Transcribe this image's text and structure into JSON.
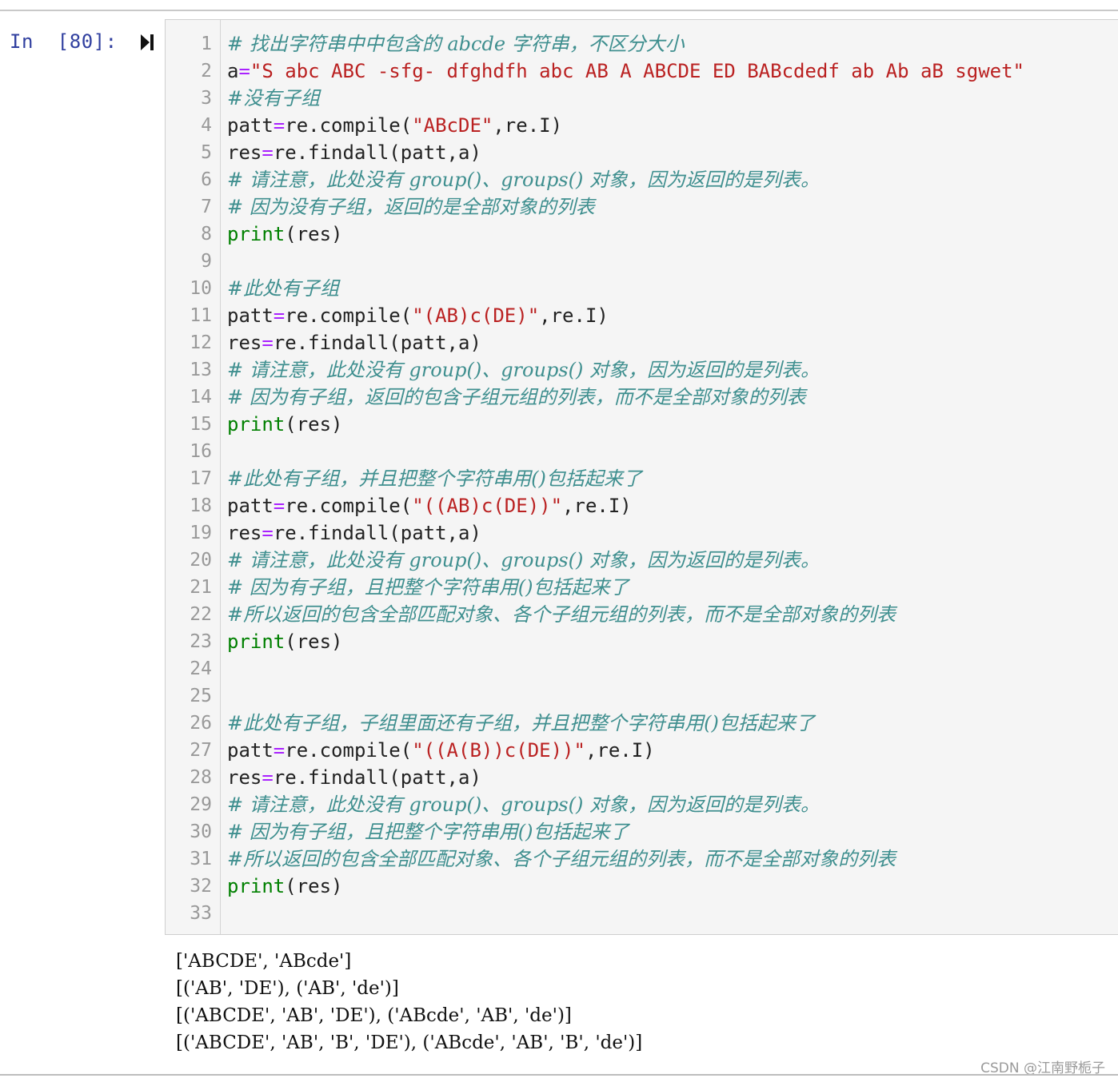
{
  "prompt": "In  [80]:",
  "lines": [
    {
      "n": "1",
      "parts": [
        {
          "t": "cm",
          "v": "# 找出字符串中中包含的 abcde 字符串，不区分大小"
        }
      ]
    },
    {
      "n": "2",
      "parts": [
        {
          "t": "tx",
          "v": "a"
        },
        {
          "t": "op",
          "v": "="
        },
        {
          "t": "st",
          "v": "\"S abc ABC -sfg- dfghdfh abc AB A ABCDE ED BABcdedf ab Ab aB sgwet\""
        }
      ]
    },
    {
      "n": "3",
      "parts": [
        {
          "t": "cm",
          "v": "#没有子组"
        }
      ]
    },
    {
      "n": "4",
      "parts": [
        {
          "t": "tx",
          "v": "patt"
        },
        {
          "t": "op",
          "v": "="
        },
        {
          "t": "tx",
          "v": "re.compile("
        },
        {
          "t": "st",
          "v": "\"ABcDE\""
        },
        {
          "t": "tx",
          "v": ",re.I)"
        }
      ]
    },
    {
      "n": "5",
      "parts": [
        {
          "t": "tx",
          "v": "res"
        },
        {
          "t": "op",
          "v": "="
        },
        {
          "t": "tx",
          "v": "re.findall(patt,a)"
        }
      ]
    },
    {
      "n": "6",
      "parts": [
        {
          "t": "cm",
          "v": "# 请注意，此处没有 group()、groups() 对象，因为返回的是列表。"
        }
      ]
    },
    {
      "n": "7",
      "parts": [
        {
          "t": "cm",
          "v": "# 因为没有子组，返回的是全部对象的列表"
        }
      ]
    },
    {
      "n": "8",
      "parts": [
        {
          "t": "kw",
          "v": "print"
        },
        {
          "t": "tx",
          "v": "(res)"
        }
      ]
    },
    {
      "n": "9",
      "parts": []
    },
    {
      "n": "10",
      "parts": [
        {
          "t": "cm",
          "v": "#此处有子组"
        }
      ]
    },
    {
      "n": "11",
      "parts": [
        {
          "t": "tx",
          "v": "patt"
        },
        {
          "t": "op",
          "v": "="
        },
        {
          "t": "tx",
          "v": "re.compile("
        },
        {
          "t": "st",
          "v": "\"(AB)c(DE)\""
        },
        {
          "t": "tx",
          "v": ",re.I)"
        }
      ]
    },
    {
      "n": "12",
      "parts": [
        {
          "t": "tx",
          "v": "res"
        },
        {
          "t": "op",
          "v": "="
        },
        {
          "t": "tx",
          "v": "re.findall(patt,a)"
        }
      ]
    },
    {
      "n": "13",
      "parts": [
        {
          "t": "cm",
          "v": "# 请注意，此处没有 group()、groups() 对象，因为返回的是列表。"
        }
      ]
    },
    {
      "n": "14",
      "parts": [
        {
          "t": "cm",
          "v": "# 因为有子组，返回的包含子组元组的列表，而不是全部对象的列表"
        }
      ]
    },
    {
      "n": "15",
      "parts": [
        {
          "t": "kw",
          "v": "print"
        },
        {
          "t": "tx",
          "v": "(res)"
        }
      ]
    },
    {
      "n": "16",
      "parts": []
    },
    {
      "n": "17",
      "parts": [
        {
          "t": "cm",
          "v": "#此处有子组，并且把整个字符串用()包括起来了"
        }
      ]
    },
    {
      "n": "18",
      "parts": [
        {
          "t": "tx",
          "v": "patt"
        },
        {
          "t": "op",
          "v": "="
        },
        {
          "t": "tx",
          "v": "re.compile("
        },
        {
          "t": "st",
          "v": "\"((AB)c(DE))\""
        },
        {
          "t": "tx",
          "v": ",re.I)"
        }
      ]
    },
    {
      "n": "19",
      "parts": [
        {
          "t": "tx",
          "v": "res"
        },
        {
          "t": "op",
          "v": "="
        },
        {
          "t": "tx",
          "v": "re.findall(patt,a)"
        }
      ]
    },
    {
      "n": "20",
      "parts": [
        {
          "t": "cm",
          "v": "# 请注意，此处没有 group()、groups() 对象，因为返回的是列表。"
        }
      ]
    },
    {
      "n": "21",
      "parts": [
        {
          "t": "cm",
          "v": "# 因为有子组，且把整个字符串用()包括起来了"
        }
      ]
    },
    {
      "n": "22",
      "parts": [
        {
          "t": "cm",
          "v": "#所以返回的包含全部匹配对象、各个子组元组的列表，而不是全部对象的列表"
        }
      ]
    },
    {
      "n": "23",
      "parts": [
        {
          "t": "kw",
          "v": "print"
        },
        {
          "t": "tx",
          "v": "(res)"
        }
      ]
    },
    {
      "n": "24",
      "parts": []
    },
    {
      "n": "25",
      "parts": []
    },
    {
      "n": "26",
      "parts": [
        {
          "t": "cm",
          "v": "#此处有子组，子组里面还有子组，并且把整个字符串用()包括起来了"
        }
      ]
    },
    {
      "n": "27",
      "parts": [
        {
          "t": "tx",
          "v": "patt"
        },
        {
          "t": "op",
          "v": "="
        },
        {
          "t": "tx",
          "v": "re.compile("
        },
        {
          "t": "st",
          "v": "\"((A(B))c(DE))\""
        },
        {
          "t": "tx",
          "v": ",re.I)"
        }
      ]
    },
    {
      "n": "28",
      "parts": [
        {
          "t": "tx",
          "v": "res"
        },
        {
          "t": "op",
          "v": "="
        },
        {
          "t": "tx",
          "v": "re.findall(patt,a)"
        }
      ]
    },
    {
      "n": "29",
      "parts": [
        {
          "t": "cm",
          "v": "# 请注意，此处没有 group()、groups() 对象，因为返回的是列表。"
        }
      ]
    },
    {
      "n": "30",
      "parts": [
        {
          "t": "cm",
          "v": "# 因为有子组，且把整个字符串用()包括起来了"
        }
      ]
    },
    {
      "n": "31",
      "parts": [
        {
          "t": "cm",
          "v": "#所以返回的包含全部匹配对象、各个子组元组的列表，而不是全部对象的列表"
        }
      ]
    },
    {
      "n": "32",
      "parts": [
        {
          "t": "kw",
          "v": "print"
        },
        {
          "t": "tx",
          "v": "(res)"
        }
      ]
    },
    {
      "n": "33",
      "parts": []
    }
  ],
  "output": [
    "['ABCDE', 'ABcde']",
    "[('AB', 'DE'), ('AB', 'de')]",
    "[('ABCDE', 'AB', 'DE'), ('ABcde', 'AB', 'de')]",
    "[('ABCDE', 'AB', 'B', 'DE'), ('ABcde', 'AB', 'B', 'de')]"
  ],
  "watermark": "CSDN @江南野栀子",
  "icons": {
    "run": "run-cell-icon"
  },
  "colors": {
    "comment": "#3f8f8f",
    "string": "#ba2121",
    "keyword": "#008000",
    "operator": "#aa22ff",
    "prompt": "#303f9f",
    "cell_bg": "#f5f5f5"
  }
}
